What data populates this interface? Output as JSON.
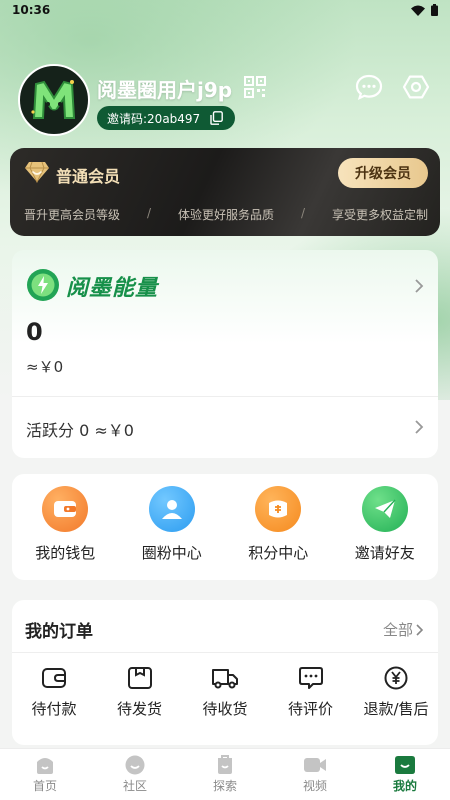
{
  "status_bar": {
    "time": "10:36"
  },
  "profile": {
    "username": "阅墨圈用户j9p",
    "invite_code": "邀请码:20ab497"
  },
  "member": {
    "title": "普通会员",
    "upgrade_label": "升级会员",
    "benefits": [
      "晋升更高会员等级",
      "体验更好服务品质",
      "享受更多权益定制"
    ],
    "separator": "/"
  },
  "energy": {
    "brand": "阅墨能量",
    "value": "0",
    "money": "≈￥0",
    "activity": "活跃分 0 ≈￥0"
  },
  "shortcuts": [
    {
      "label": "我的钱包",
      "icon": "wallet-icon",
      "color": "#f2792a"
    },
    {
      "label": "圈粉中心",
      "icon": "fans-icon",
      "color": "#2c9cf0"
    },
    {
      "label": "积分中心",
      "icon": "points-icon",
      "color": "#f58a1f"
    },
    {
      "label": "邀请好友",
      "icon": "invite-icon",
      "color": "#22b055"
    }
  ],
  "orders": {
    "title": "我的订单",
    "all_label": "全部",
    "items": [
      {
        "label": "待付款",
        "icon": "wallet-outline-icon"
      },
      {
        "label": "待发货",
        "icon": "package-icon"
      },
      {
        "label": "待收货",
        "icon": "truck-icon"
      },
      {
        "label": "待评价",
        "icon": "comment-icon"
      },
      {
        "label": "退款/售后",
        "icon": "yen-circle-icon"
      }
    ]
  },
  "nav": [
    {
      "label": "首页",
      "icon": "home-icon"
    },
    {
      "label": "社区",
      "icon": "community-icon"
    },
    {
      "label": "探索",
      "icon": "explore-icon"
    },
    {
      "label": "视频",
      "icon": "video-icon"
    },
    {
      "label": "我的",
      "icon": "profile-icon",
      "active": true
    }
  ],
  "colors": {
    "brand_green": "#17904a",
    "invite_pill": "#0f5a34",
    "member_gold": "#f3dfb7",
    "nav_active": "#1a7a3e"
  }
}
